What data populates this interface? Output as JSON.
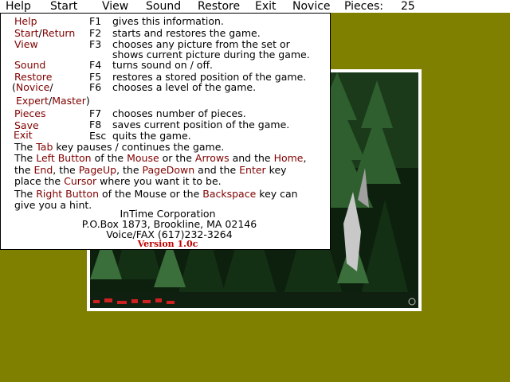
{
  "menu": {
    "help": "Help",
    "start": "Start",
    "view": "View",
    "sound": "Sound",
    "restore": "Restore",
    "exit": "Exit",
    "level": "Novice",
    "pieces_label": "Pieces:",
    "pieces_value": "25"
  },
  "help": {
    "commands": [
      {
        "name": "Help",
        "key": "F1",
        "desc": "gives this information."
      },
      {
        "name": "Start",
        "sep": "/",
        "name2": "Return",
        "key": "F2",
        "desc": "starts and restores the game."
      },
      {
        "name": "View",
        "key": "F3",
        "desc": "chooses any picture from the set  or",
        "desc2": "shows current picture during the game."
      },
      {
        "name": "Sound",
        "key": "F4",
        "desc": "turns sound on / off."
      },
      {
        "name": "Restore",
        "key": "F5",
        "desc": "restores a stored position of the game."
      },
      {
        "open": "(",
        "name": "Novice",
        "sep": "/",
        "key": "F6",
        "desc": "chooses a level of the game.",
        "name2": "Expert",
        "sep2": "/",
        "name3": "Master",
        "close": ")"
      },
      {
        "name": "Pieces",
        "key": "F7",
        "desc": "chooses number of pieces."
      },
      {
        "name": "Save",
        "key": "F8",
        "desc": "saves current position of the game."
      },
      {
        "name": "Exit",
        "key": "Esc",
        "desc": "quits the game."
      }
    ],
    "para1": {
      "a": "The ",
      "tab": "Tab",
      "b": " key pauses / continues the game."
    },
    "para2": {
      "a": "The ",
      "left_button": "Left Button",
      "b": " of the ",
      "mouse": "Mouse",
      "c": " or the ",
      "arrows": "Arrows",
      "d": " and the ",
      "home": "Home",
      "e": ",",
      "f": "the ",
      "end": "End",
      "g": ", the ",
      "pageup": "PageUp",
      "h": ", the ",
      "pagedown": "PageDown",
      "i": "  and the ",
      "enter": "Enter",
      "j": " key",
      "k": "place the ",
      "cursor": "Cursor",
      "l": " where you want it to be."
    },
    "para3": {
      "a": "The ",
      "right_button": "Right Button",
      "b": " of the Mouse or the ",
      "backspace": "Backspace",
      "c": " key can",
      "d": "give you a hint."
    },
    "company": "InTime Corporation",
    "address": "P.O.Box 1873, Brookline, MA 02146",
    "phone": "Voice/FAX (617)232-3264",
    "version": "Version 1.0c"
  }
}
